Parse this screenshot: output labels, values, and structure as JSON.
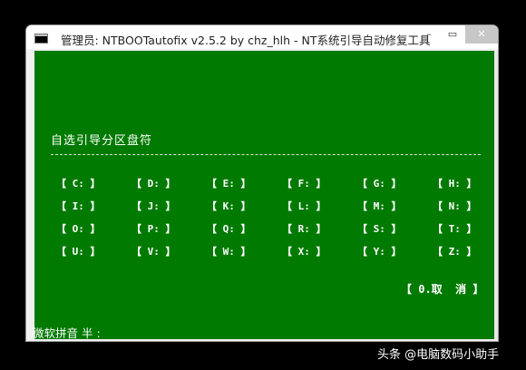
{
  "window": {
    "title": "管理员:  NTBOOTautofix v2.5.2 by chz_hlh - NT系统引导自动修复工具",
    "minimize_label": "–",
    "maximize_label": "▭",
    "close_label": "✕"
  },
  "console": {
    "prompt": "自选引导分区盘符",
    "drives": [
      [
        "【 C: 】",
        "【 D: 】",
        "【 E: 】",
        "【 F: 】",
        "【 G: 】",
        "【 H: 】"
      ],
      [
        "【 I: 】",
        "【 J: 】",
        "【 K: 】",
        "【 L: 】",
        "【 M: 】",
        "【 N: 】"
      ],
      [
        "【 O: 】",
        "【 P: 】",
        "【 Q: 】",
        "【 R: 】",
        "【 S: 】",
        "【 T: 】"
      ],
      [
        "【 U: 】",
        "【 V: 】",
        "【 W: 】",
        "【 X: 】",
        "【 Y: 】",
        "【 Z: 】"
      ]
    ],
    "cancel_label": "【 0.取  消 】",
    "ime_status": "微软拼音 半 :"
  },
  "watermark": "头条 @电脑数码小助手",
  "colors": {
    "console_bg": "#007a00",
    "console_text": "#ffffff",
    "page_bg": "#000000"
  }
}
